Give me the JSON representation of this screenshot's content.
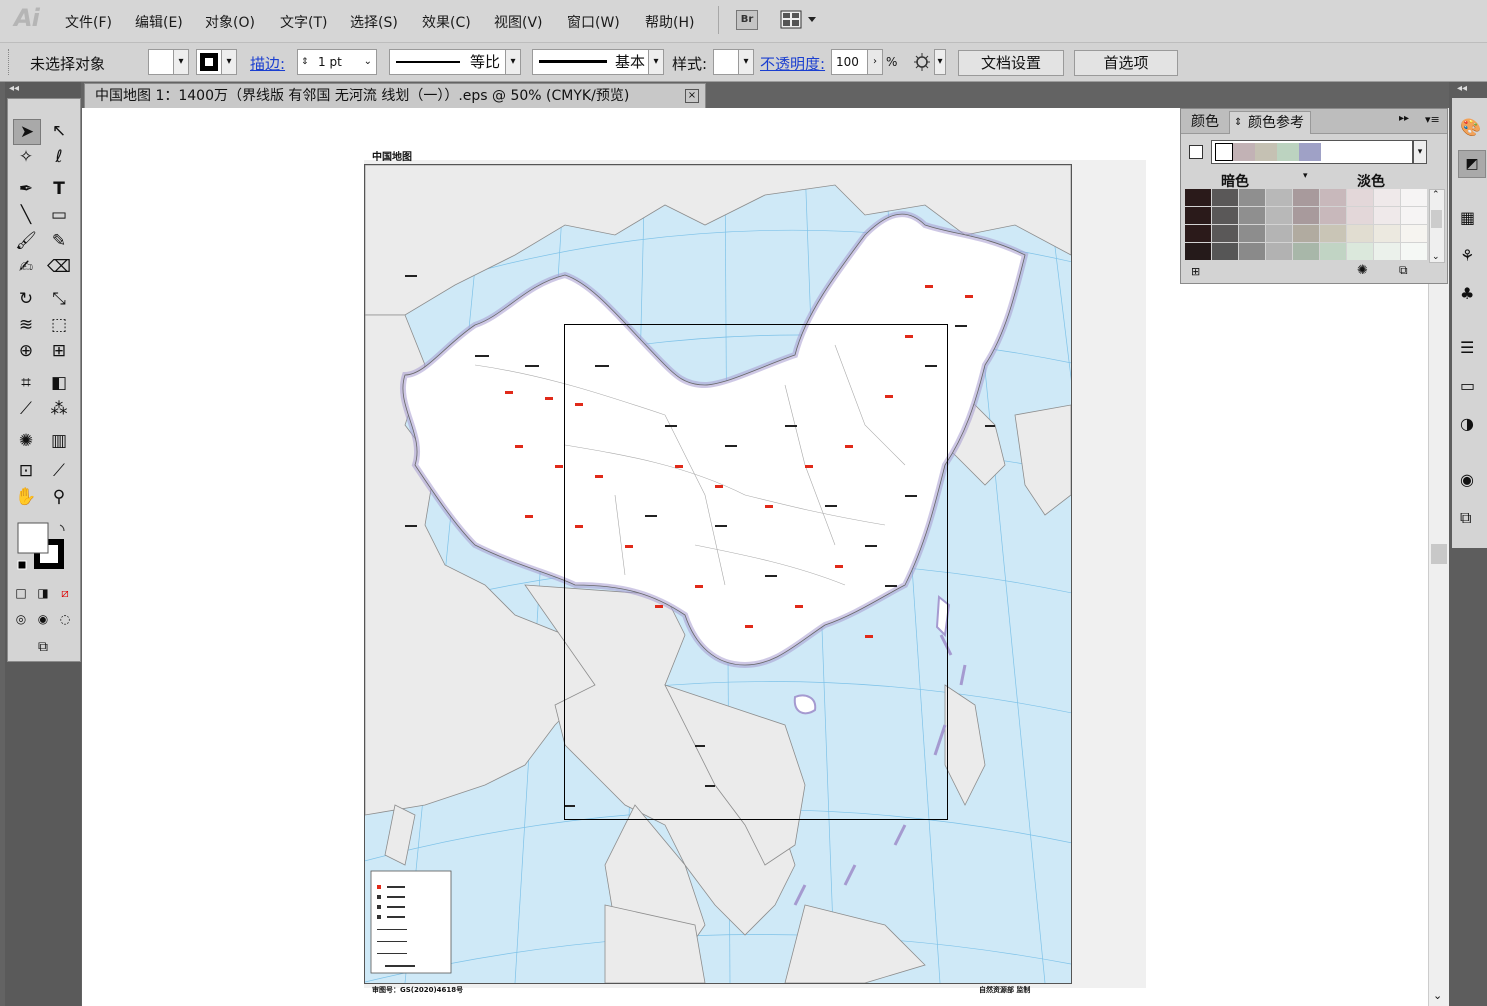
{
  "app": {
    "logo": "Ai",
    "menu": [
      "文件(F)",
      "编辑(E)",
      "对象(O)",
      "文字(T)",
      "选择(S)",
      "效果(C)",
      "视图(V)",
      "窗口(W)",
      "帮助(H)"
    ],
    "bridge_label": "Br"
  },
  "control_bar": {
    "selection_status": "未选择对象",
    "stroke_label": "描边:",
    "stroke_weight": "1 pt",
    "profile_label": "等比",
    "brush_label": "基本",
    "style_label": "样式:",
    "opacity_label": "不透明度:",
    "opacity_value": "100",
    "percent": "%",
    "doc_setup": "文档设置",
    "preferences": "首选项"
  },
  "document": {
    "tab_title": "中国地图 1：1400万（界线版 有邻国 无河流 线划（一））.eps @ 50% (CMYK/预览)",
    "close": "×"
  },
  "map": {
    "title": "中国地图",
    "footer_left": "审图号：GS(2020)4618号",
    "footer_right": "自然资源部 监制"
  },
  "color_panel": {
    "tab_color": "颜色",
    "tab_guide": "颜色参考",
    "shades_label": "暗色",
    "tints_label": "淡色",
    "harmony": [
      "#ffffff",
      "#c2b2b5",
      "#c5c1b3",
      "#bcd3c0",
      "#9fa1c6"
    ],
    "swatch_rows": [
      [
        "#2a1a1a",
        "#5a5858",
        "#8f8f8f",
        "#b8b8b8",
        "#a89a9c",
        "#c8b8bb",
        "#e3d7d9",
        "#efe9ea",
        "#f6f4f4"
      ],
      [
        "#2b1a1a",
        "#5a5858",
        "#8d8d8d",
        "#b4b4b4",
        "#b1aba0",
        "#c9c5b6",
        "#e1ddd1",
        "#ece9e0",
        "#f6f4f0"
      ],
      [
        "#251a1a",
        "#565656",
        "#8a8a8a",
        "#b2b2b2",
        "#a8b7a9",
        "#c1d4c4",
        "#dbe8dc",
        "#ebf1eb",
        "#f5f8f5"
      ]
    ]
  },
  "colors": {
    "menubar": "#d6d6d6",
    "workspace": "#636363",
    "sea": "#cfe9f7",
    "china": "#ffffff",
    "neighbors": "#ebebeb",
    "border_glow": "#9a8fc7",
    "graticule": "#7ec2e8",
    "city": "#e02a1a"
  }
}
